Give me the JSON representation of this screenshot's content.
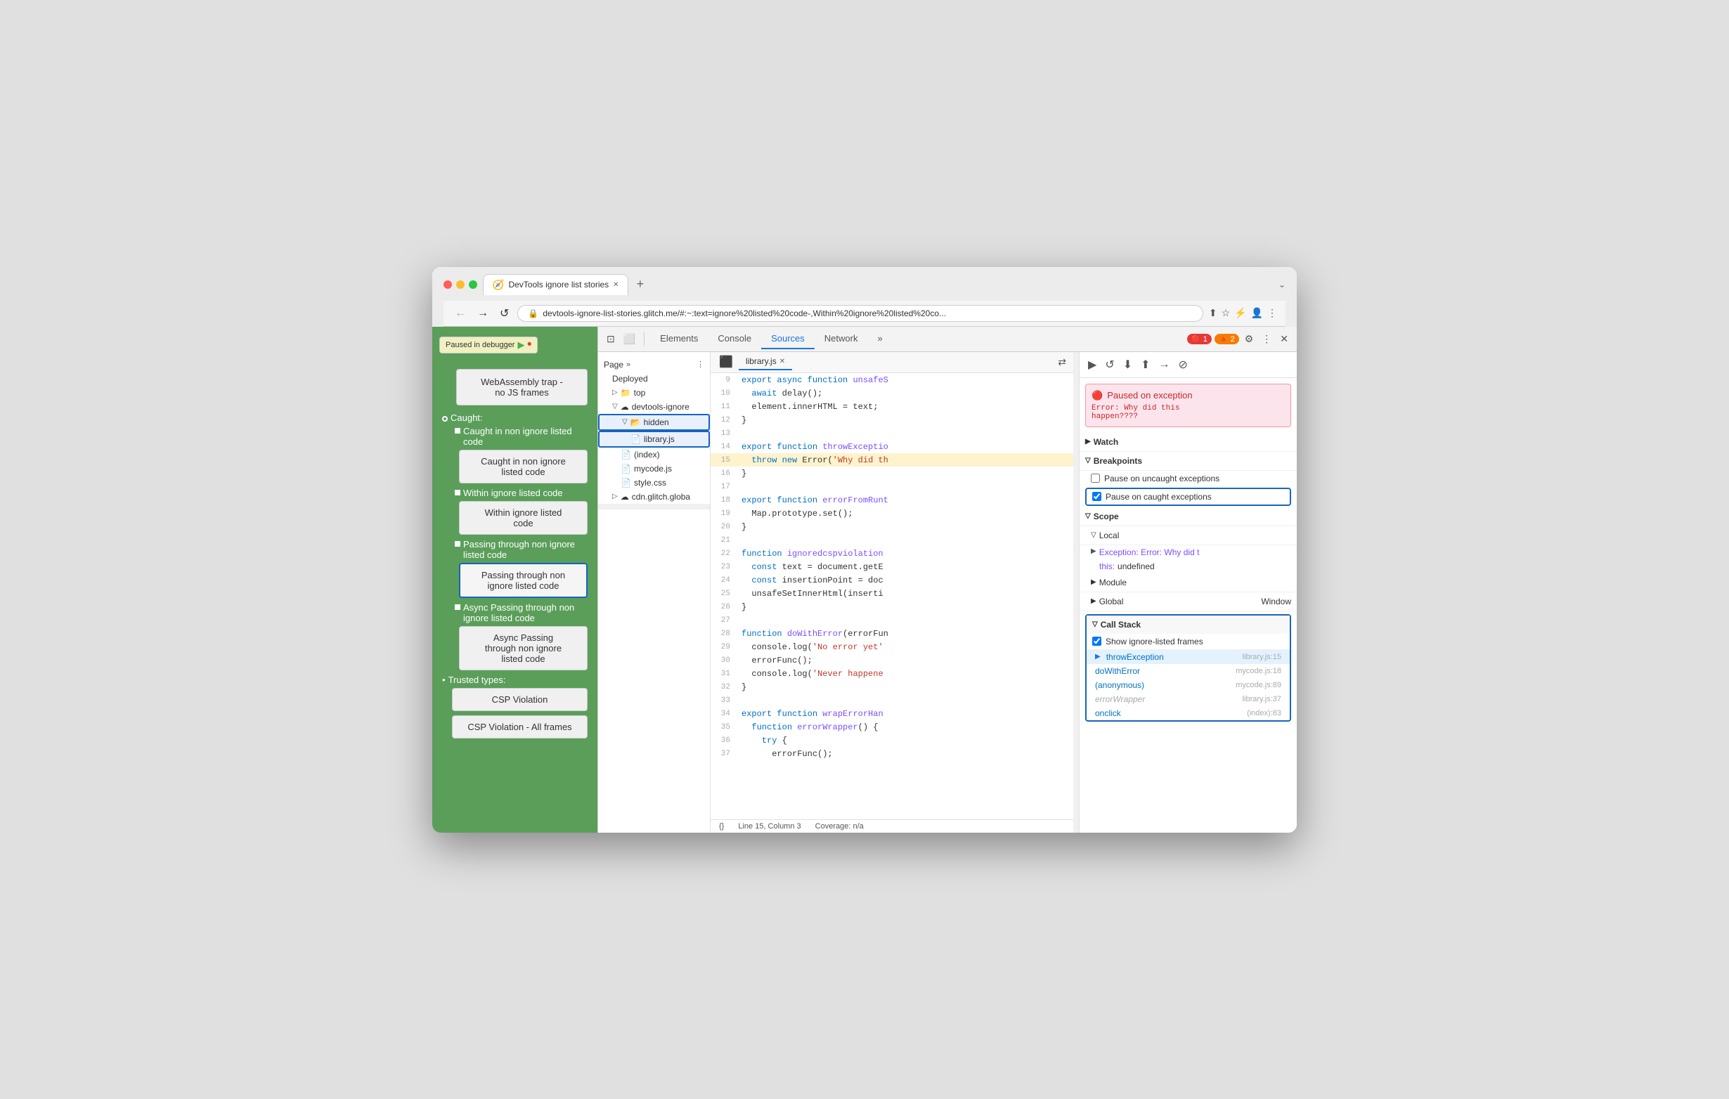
{
  "browser": {
    "traffic_lights": [
      "red",
      "yellow",
      "green"
    ],
    "tab_title": "DevTools ignore list stories",
    "tab_icon": "🧭",
    "new_tab_icon": "+",
    "overflow_icon": "⌄",
    "nav_back": "←",
    "nav_forward": "→",
    "nav_refresh": "↺",
    "url": "devtools-ignore-list-stories.glitch.me/#:~:text=ignore%20listed%20code-,Within%20ignore%20listed%20co...",
    "lock_icon": "🔒",
    "toolbar_icons": [
      "⬆",
      "☆",
      "⚡",
      "🖬",
      "☰"
    ]
  },
  "page": {
    "paused_badge": "Paused in debugger",
    "items": [
      "WebAssembly trap - no JS frames"
    ],
    "caught_label": "Caught:",
    "caught_items": [
      {
        "label": "Caught in non ignore listed code",
        "btn": "Caught in non ignore\nlisted code",
        "active": false
      },
      {
        "label": "Within ignore listed code",
        "btn": "Within ignore listed\ncode",
        "active": false
      },
      {
        "label": "Passing through non ignore listed code",
        "btn": "Passing through non\nignore listed code",
        "active": true
      },
      {
        "label": "Async Passing through non ignore listed code",
        "btn": "Async Passing\nthrough non ignore\nlisted code",
        "active": false
      }
    ],
    "trusted_label": "Trusted types:",
    "trusted_items": [
      "CSP Violation",
      "CSP Violation - All frames"
    ]
  },
  "devtools": {
    "toolbar_icons_left": [
      "⊡",
      "⬜"
    ],
    "tabs": [
      "Elements",
      "Console",
      "Sources",
      "Network",
      "»"
    ],
    "active_tab": "Sources",
    "error_count": "1",
    "warn_count": "2",
    "settings_icon": "⚙",
    "more_icon": "⋮",
    "close_icon": "✕"
  },
  "file_tree": {
    "items": [
      {
        "label": "Deployed",
        "indent": 0,
        "type": "section",
        "icon": ""
      },
      {
        "label": "top",
        "indent": 1,
        "type": "folder",
        "icon": "▷"
      },
      {
        "label": "devtools-ignore",
        "indent": 1,
        "type": "cloud-folder",
        "icon": "▽"
      },
      {
        "label": "hidden",
        "indent": 2,
        "type": "folder",
        "icon": "▽",
        "highlight": true
      },
      {
        "label": "library.js",
        "indent": 3,
        "type": "file",
        "icon": "",
        "highlight": true
      },
      {
        "label": "(index)",
        "indent": 2,
        "type": "file",
        "icon": ""
      },
      {
        "label": "mycode.js",
        "indent": 2,
        "type": "file",
        "icon": ""
      },
      {
        "label": "style.css",
        "indent": 2,
        "type": "file",
        "icon": ""
      },
      {
        "label": "cdn.glitch.globa",
        "indent": 1,
        "type": "cloud-folder",
        "icon": "▷"
      }
    ]
  },
  "editor": {
    "tab_label": "library.js",
    "lines": [
      {
        "num": 9,
        "code": "  await delay();",
        "type": "normal"
      },
      {
        "num": 10,
        "code": "  element.innerHTML = text;",
        "type": "normal"
      },
      {
        "num": 11,
        "code": "}",
        "type": "normal"
      },
      {
        "num": 12,
        "code": "",
        "type": "normal"
      },
      {
        "num": 14,
        "code": "export function throwExceptio",
        "type": "normal"
      },
      {
        "num": 15,
        "code": "  throw new Error('Why did th",
        "type": "error"
      },
      {
        "num": 16,
        "code": "}",
        "type": "normal"
      },
      {
        "num": 17,
        "code": "",
        "type": "normal"
      },
      {
        "num": 18,
        "code": "export function errorFromRunt",
        "type": "normal"
      },
      {
        "num": 19,
        "code": "  Map.prototype.set();",
        "type": "normal"
      },
      {
        "num": 20,
        "code": "}",
        "type": "normal"
      },
      {
        "num": 21,
        "code": "",
        "type": "normal"
      },
      {
        "num": 22,
        "code": "function ignoredcspviolation",
        "type": "normal"
      },
      {
        "num": 23,
        "code": "  const text = document.getE",
        "type": "normal"
      },
      {
        "num": 24,
        "code": "  const insertionPoint = doc",
        "type": "normal"
      },
      {
        "num": 25,
        "code": "  unsafeSetInnerHtml(inserti",
        "type": "normal"
      },
      {
        "num": 26,
        "code": "}",
        "type": "normal"
      },
      {
        "num": 27,
        "code": "",
        "type": "normal"
      },
      {
        "num": 28,
        "code": "function doWithError(errorFun",
        "type": "normal"
      },
      {
        "num": 29,
        "code": "  console.log('No error yet'",
        "type": "normal"
      },
      {
        "num": 30,
        "code": "  errorFunc();",
        "type": "normal"
      },
      {
        "num": 31,
        "code": "  console.log('Never happene",
        "type": "normal"
      },
      {
        "num": 32,
        "code": "}",
        "type": "normal"
      },
      {
        "num": 33,
        "code": "",
        "type": "normal"
      },
      {
        "num": 34,
        "code": "export function wrapErrorHan",
        "type": "normal"
      },
      {
        "num": 35,
        "code": "  function errorWrapper() {",
        "type": "normal"
      },
      {
        "num": 36,
        "code": "    try {",
        "type": "normal"
      },
      {
        "num": 37,
        "code": "      errorFunc();",
        "type": "normal"
      }
    ],
    "status_line": "Line 15, Column 3",
    "coverage": "Coverage: n/a"
  },
  "debugger": {
    "toolbar_btns": [
      "▶",
      "↺",
      "⬇",
      "⬆",
      "→"
    ],
    "exception_title": "Paused on exception",
    "exception_msg": "Error: Why did this\nhappen????",
    "sections": {
      "watch": "Watch",
      "breakpoints": "Breakpoints",
      "scope": "Scope",
      "local": "Local",
      "module": "Module",
      "global": "Global",
      "call_stack": "Call Stack"
    },
    "pause_uncaught": "Pause on uncaught exceptions",
    "pause_caught": "Pause on caught exceptions",
    "pause_caught_checked": true,
    "scope_items": [
      {
        "label": "Exception: Error: Why did t",
        "type": "expandable"
      },
      {
        "label": "this:",
        "value": "undefined",
        "type": "value"
      }
    ],
    "global_value": "Window",
    "show_ignore_frames": "Show ignore-listed frames",
    "stack_frames": [
      {
        "name": "throwException",
        "loc": "library.js:15",
        "active": true,
        "ignore": false,
        "arrow": true
      },
      {
        "name": "doWithError",
        "loc": "mycode.js:18",
        "active": false,
        "ignore": false
      },
      {
        "name": "(anonymous)",
        "loc": "mycode.js:89",
        "active": false,
        "ignore": false
      },
      {
        "name": "errorWrapper",
        "loc": "library.js:37",
        "active": false,
        "ignore": true
      },
      {
        "name": "onclick",
        "loc": "(index):83",
        "active": false,
        "ignore": false
      }
    ]
  }
}
